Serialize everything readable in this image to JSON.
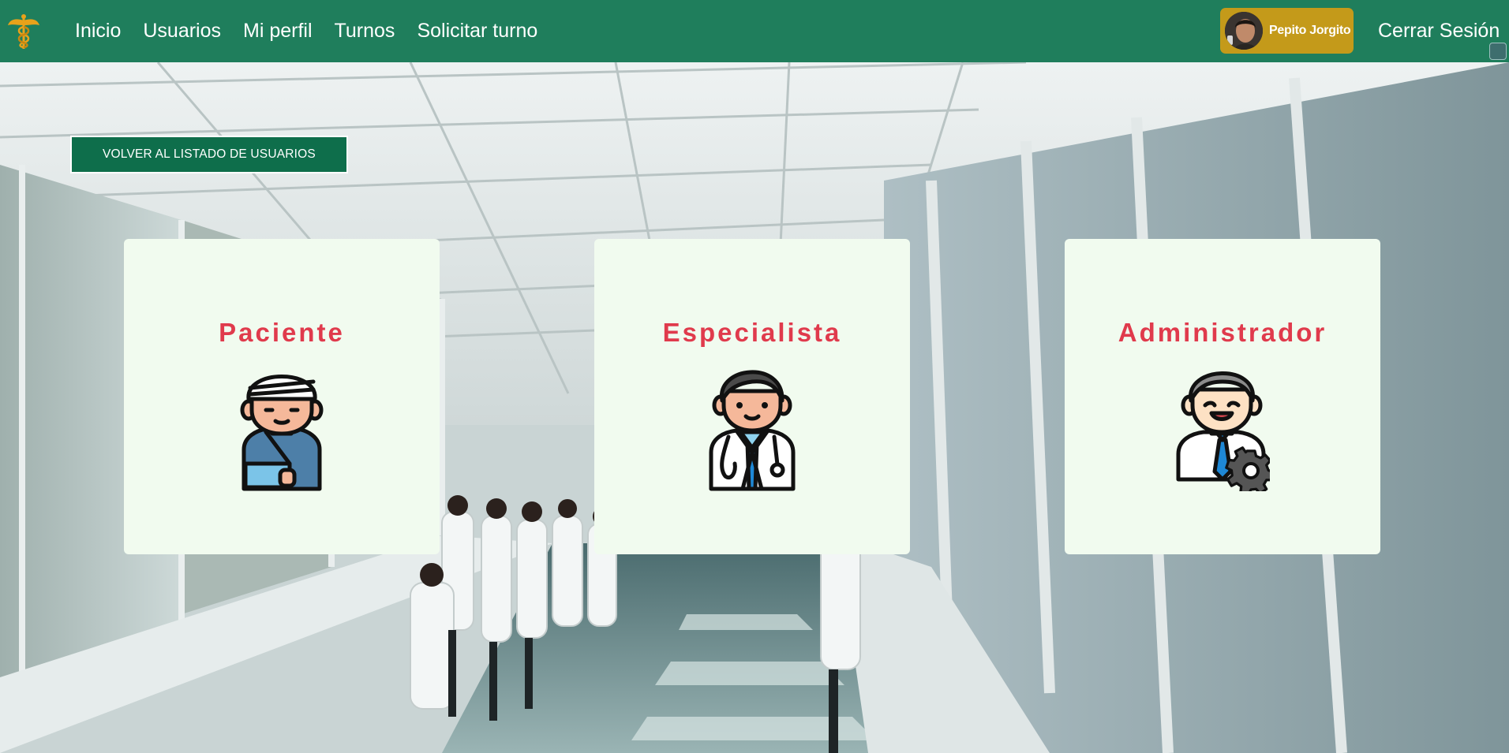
{
  "navbar": {
    "logo_icon": "caduceus-icon",
    "links": [
      "Inicio",
      "Usuarios",
      "Mi perfil",
      "Turnos",
      "Solicitar turno"
    ],
    "user_name": "Pepito Jorgito",
    "logout_label": "Cerrar Sesión",
    "background_color": "#1f7e5c",
    "user_chip_color": "#c49a1a"
  },
  "page": {
    "back_button_label": "VOLVER AL LISTADO DE USUARIOS",
    "back_button_color": "#0e6e4b"
  },
  "roles": [
    {
      "label": "Paciente",
      "icon": "patient-icon"
    },
    {
      "label": "Especialista",
      "icon": "doctor-icon"
    },
    {
      "label": "Administrador",
      "icon": "admin-icon"
    }
  ],
  "colors": {
    "card_background": "#f1fbef",
    "role_title": "#e03a4c"
  }
}
